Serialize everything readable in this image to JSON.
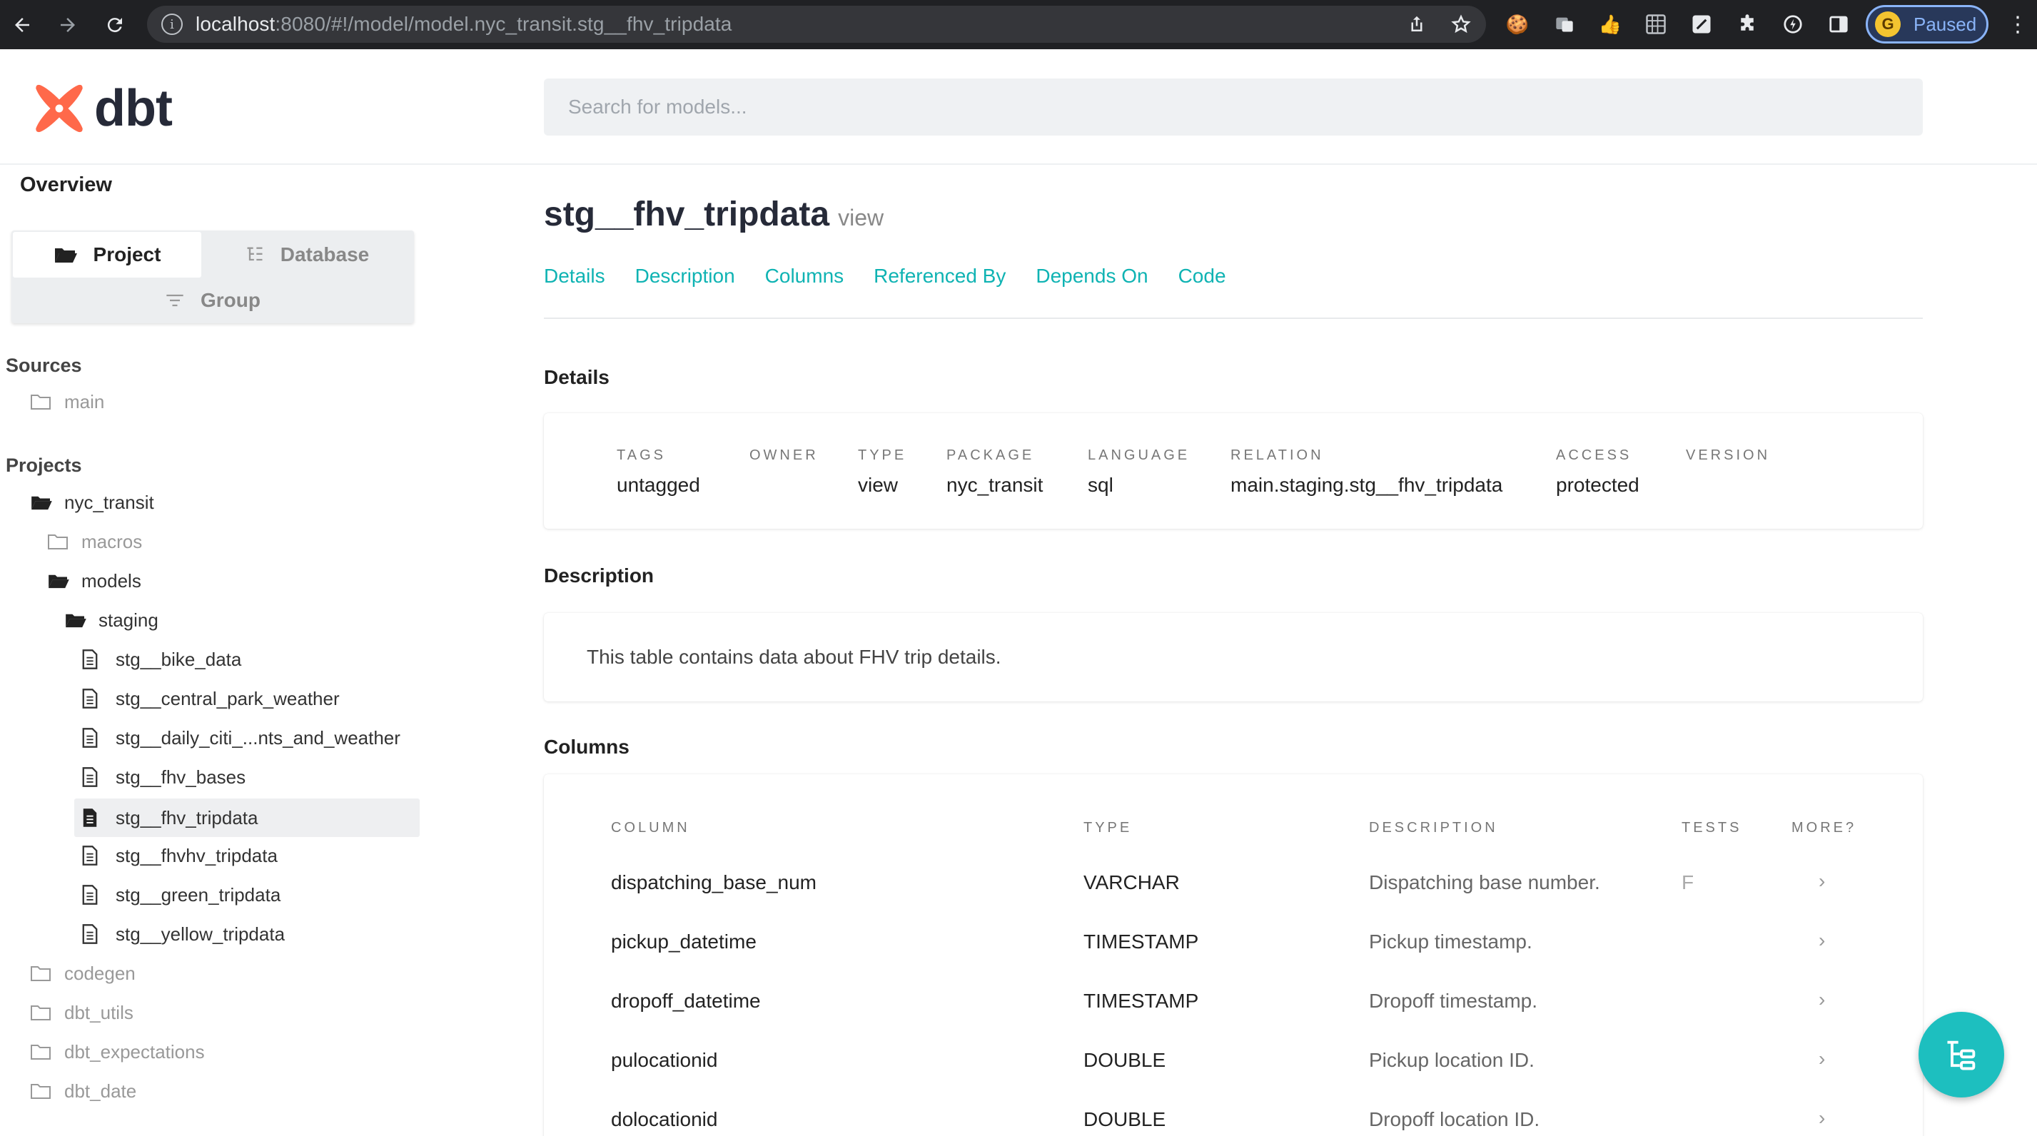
{
  "browser": {
    "url_host": "localhost",
    "url_rest": ":8080/#!/model/model.nyc_transit.stg__fhv_tripdata",
    "profile_status": "Paused"
  },
  "header": {
    "brand": "dbt",
    "search_placeholder": "Search for models..."
  },
  "sidebar": {
    "overview": "Overview",
    "tabs": {
      "project": "Project",
      "database": "Database",
      "group": "Group"
    },
    "sources_label": "Sources",
    "sources": [
      "main"
    ],
    "projects_label": "Projects",
    "project_name": "nyc_transit",
    "folders": {
      "macros": "macros",
      "models": "models",
      "staging": "staging"
    },
    "staging_models": [
      "stg__bike_data",
      "stg__central_park_weather",
      "stg__daily_citi_...nts_and_weather",
      "stg__fhv_bases",
      "stg__fhv_tripdata",
      "stg__fhvhv_tripdata",
      "stg__green_tripdata",
      "stg__yellow_tripdata"
    ],
    "packages": [
      "codegen",
      "dbt_utils",
      "dbt_expectations",
      "dbt_date"
    ]
  },
  "main": {
    "title": "stg__fhv_tripdata",
    "kind": "view",
    "tabs": [
      "Details",
      "Description",
      "Columns",
      "Referenced By",
      "Depends On",
      "Code"
    ],
    "details_heading": "Details",
    "details": [
      {
        "key": "TAGS",
        "value": "untagged"
      },
      {
        "key": "OWNER",
        "value": ""
      },
      {
        "key": "TYPE",
        "value": "view"
      },
      {
        "key": "PACKAGE",
        "value": "nyc_transit"
      },
      {
        "key": "LANGUAGE",
        "value": "sql"
      },
      {
        "key": "RELATION",
        "value": "main.staging.stg__fhv_tripdata"
      },
      {
        "key": "ACCESS",
        "value": "protected"
      },
      {
        "key": "VERSION",
        "value": ""
      }
    ],
    "description_heading": "Description",
    "description": "This table contains data about FHV trip details.",
    "columns_heading": "Columns",
    "column_headers": [
      "COLUMN",
      "TYPE",
      "DESCRIPTION",
      "TESTS",
      "MORE?"
    ],
    "columns": [
      {
        "name": "dispatching_base_num",
        "type": "VARCHAR",
        "description": "Dispatching base number.",
        "tests": "F"
      },
      {
        "name": "pickup_datetime",
        "type": "TIMESTAMP",
        "description": "Pickup timestamp.",
        "tests": ""
      },
      {
        "name": "dropoff_datetime",
        "type": "TIMESTAMP",
        "description": "Dropoff timestamp.",
        "tests": ""
      },
      {
        "name": "pulocationid",
        "type": "DOUBLE",
        "description": "Pickup location ID.",
        "tests": ""
      },
      {
        "name": "dolocationid",
        "type": "DOUBLE",
        "description": "Dropoff location ID.",
        "tests": ""
      }
    ],
    "more_glyph": "›"
  },
  "colors": {
    "accent": "#0fb3b3",
    "fab": "#1dbfbf",
    "logo": "#ff694a"
  }
}
